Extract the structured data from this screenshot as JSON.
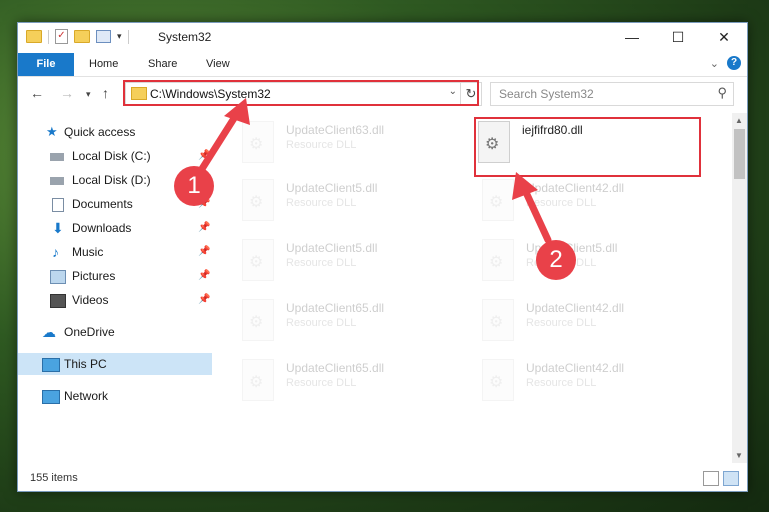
{
  "window": {
    "title": "System32"
  },
  "ribbon": {
    "tabs": [
      "File",
      "Home",
      "Share",
      "View"
    ],
    "help": "?"
  },
  "nav": {
    "address": "C:\\Windows\\System32",
    "search_placeholder": "Search System32"
  },
  "sidebar": {
    "items": [
      {
        "label": "Quick access",
        "icon": "star-icon",
        "pinned": false
      },
      {
        "label": "Local Disk (C:)",
        "icon": "disk-icon",
        "pinned": true
      },
      {
        "label": "Local Disk (D:)",
        "icon": "disk-icon",
        "pinned": true
      },
      {
        "label": "Documents",
        "icon": "documents-icon",
        "pinned": true
      },
      {
        "label": "Downloads",
        "icon": "downloads-icon",
        "pinned": true
      },
      {
        "label": "Music",
        "icon": "music-icon",
        "pinned": true
      },
      {
        "label": "Pictures",
        "icon": "pictures-icon",
        "pinned": true
      },
      {
        "label": "Videos",
        "icon": "videos-icon",
        "pinned": true
      },
      {
        "label": "OneDrive",
        "icon": "cloud-icon",
        "pinned": false
      },
      {
        "label": "This PC",
        "icon": "computer-icon",
        "pinned": false,
        "selected": true
      },
      {
        "label": "Network",
        "icon": "network-icon",
        "pinned": false
      }
    ]
  },
  "files": [
    {
      "name": "UpdateClient63.dll",
      "type": "Resource DLL",
      "faded": true
    },
    {
      "name": "iejfifrd80.dll",
      "type": "",
      "faded": false
    },
    {
      "name": "UpdateClient5.dll",
      "type": "Resource DLL",
      "faded": true
    },
    {
      "name": "UpdateClient42.dll",
      "type": "Resource DLL",
      "faded": true
    },
    {
      "name": "UpdateClient5.dll",
      "type": "Resource DLL",
      "faded": true
    },
    {
      "name": "UpdateClient5.dll",
      "type": "Resource DLL",
      "faded": true
    },
    {
      "name": "UpdateClient65.dll",
      "type": "Resource DLL",
      "faded": true
    },
    {
      "name": "UpdateClient42.dll",
      "type": "Resource DLL",
      "faded": true
    },
    {
      "name": "UpdateClient65.dll",
      "type": "Resource DLL",
      "faded": true
    },
    {
      "name": "UpdateClient42.dll",
      "type": "Resource DLL",
      "faded": true
    }
  ],
  "status": {
    "items_count": "155 items"
  },
  "callouts": [
    "1",
    "2"
  ],
  "colors": {
    "accent": "#1979ca",
    "highlight_box": "#e0313b",
    "callout": "#e94149",
    "selected": "#cce4f7"
  }
}
